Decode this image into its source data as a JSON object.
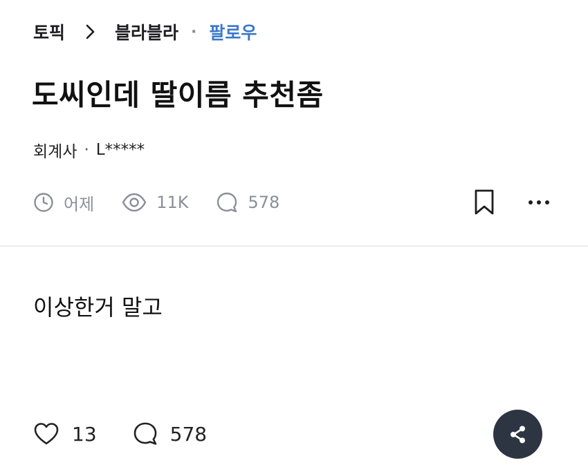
{
  "breadcrumb": {
    "topic_label": "토픽",
    "board_label": "블라블라",
    "separator": "·",
    "follow_label": "팔로우"
  },
  "post": {
    "title": "도씨인데 딸이름 추천좀",
    "author_company": "회계사",
    "author_separator": "·",
    "author_name": "L*****",
    "time": "어제",
    "views": "11K",
    "comments": "578",
    "body": "이상한거 말고",
    "likes": "13",
    "footer_comments": "578"
  },
  "icons": {
    "chevron": "chevron-right-icon",
    "clock": "clock-icon",
    "eye": "eye-icon",
    "comment": "comment-bubble-icon",
    "bookmark": "bookmark-icon",
    "more": "more-dots-icon",
    "heart": "heart-icon",
    "share": "share-icon"
  },
  "colors": {
    "follow_blue": "#3a78c9",
    "meta_gray": "#8a8f98",
    "share_button_bg": "#2d3542",
    "divider": "#ececee"
  }
}
